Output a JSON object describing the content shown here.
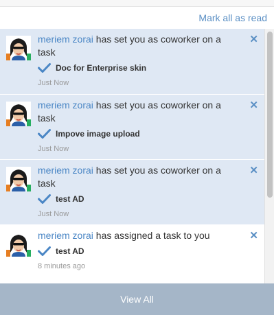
{
  "header": {
    "mark_all_label": "Mark all as read"
  },
  "notifications": [
    {
      "actor": "meriem zorai",
      "message": " has set you as coworker on a task",
      "task": "Doc for Enterprise skin",
      "time": "Just Now",
      "state": "unread"
    },
    {
      "actor": "meriem zorai",
      "message": " has set you as coworker on a task",
      "task": "Impove image upload",
      "time": "Just Now",
      "state": "unread"
    },
    {
      "actor": "meriem zorai",
      "message": " has set you as coworker on a task",
      "task": "test AD",
      "time": "Just Now",
      "state": "unread"
    },
    {
      "actor": "meriem zorai",
      "message": " has assigned a task to you",
      "task": "test AD",
      "time": "8 minutes ago",
      "state": "read"
    }
  ],
  "icons": {
    "close": "close-icon",
    "check": "checkmark-icon",
    "avatar": "user-avatar"
  },
  "colors": {
    "unread_bg": "#dfe8f4",
    "link": "#4a86c5",
    "check": "#4a86c5",
    "footer_bg": "#a5b6c8"
  },
  "footer": {
    "view_all_label": "View All"
  }
}
